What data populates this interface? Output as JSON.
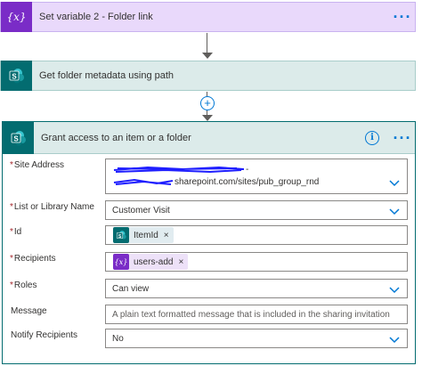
{
  "steps": [
    {
      "title": "Set variable 2 - Folder link",
      "icon": "variable-icon",
      "menu": "···"
    },
    {
      "title": "Get folder metadata using path",
      "icon": "sharepoint-icon"
    }
  ],
  "connector": {
    "add_label": "+"
  },
  "action": {
    "title": "Grant access to an item or a folder",
    "info_glyph": "i",
    "menu": "···",
    "fields": {
      "site_address": {
        "label": "Site Address",
        "line1_suffix": "-",
        "line2_value": "sharepoint.com/sites/pub_group_rnd"
      },
      "list": {
        "label": "List or Library Name",
        "value": "Customer Visit"
      },
      "id": {
        "label": "Id",
        "token": "ItemId",
        "remove": "×"
      },
      "recipients": {
        "label": "Recipients",
        "token": "users-add",
        "remove": "×"
      },
      "roles": {
        "label": "Roles",
        "value": "Can view"
      },
      "message": {
        "label": "Message",
        "placeholder": "A plain text formatted message that is included in the sharing invitation"
      },
      "notify": {
        "label": "Notify Recipients",
        "value": "No"
      }
    },
    "required_marker": "*"
  },
  "colors": {
    "variable": "#7a2cc7",
    "sharepoint": "#036c70",
    "accent": "#0078d4",
    "redaction": "#1f1fff"
  }
}
